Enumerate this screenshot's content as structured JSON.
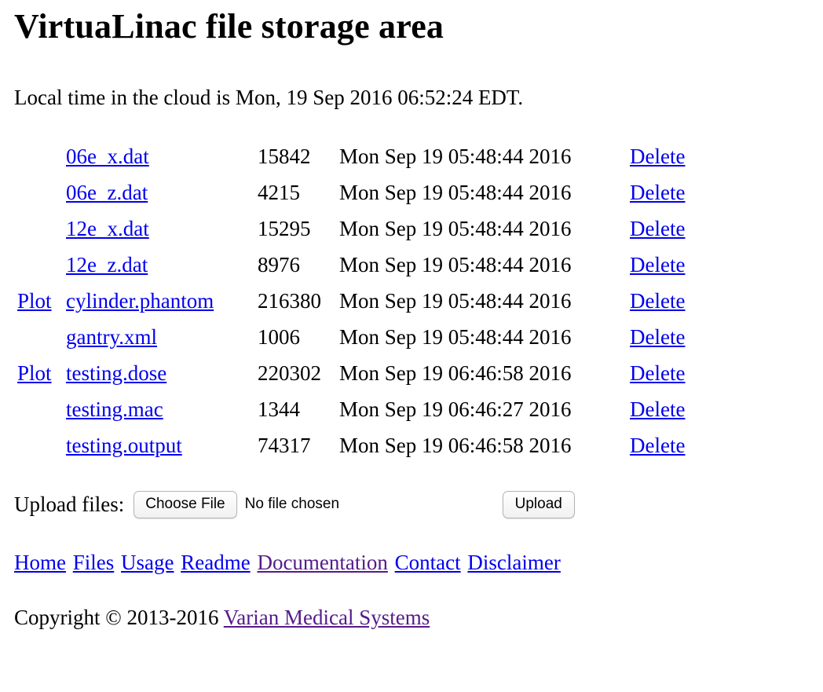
{
  "page": {
    "title": "VirtuaLinac file storage area",
    "local_time_text": "Local time in the cloud is Mon, 19 Sep 2016 06:52:24 EDT."
  },
  "files": [
    {
      "plot": "",
      "name": "06e_x.dat",
      "size": "15842",
      "date": "Mon Sep 19 05:48:44 2016",
      "delete": "Delete"
    },
    {
      "plot": "",
      "name": "06e_z.dat",
      "size": "4215",
      "date": "Mon Sep 19 05:48:44 2016",
      "delete": "Delete"
    },
    {
      "plot": "",
      "name": "12e_x.dat",
      "size": "15295",
      "date": "Mon Sep 19 05:48:44 2016",
      "delete": "Delete"
    },
    {
      "plot": "",
      "name": "12e_z.dat",
      "size": "8976",
      "date": "Mon Sep 19 05:48:44 2016",
      "delete": "Delete"
    },
    {
      "plot": "Plot",
      "name": "cylinder.phantom",
      "size": "216380",
      "date": "Mon Sep 19 05:48:44 2016",
      "delete": "Delete"
    },
    {
      "plot": "",
      "name": "gantry.xml",
      "size": "1006",
      "date": "Mon Sep 19 05:48:44 2016",
      "delete": "Delete"
    },
    {
      "plot": "Plot",
      "name": "testing.dose",
      "size": "220302",
      "date": "Mon Sep 19 06:46:58 2016",
      "delete": "Delete"
    },
    {
      "plot": "",
      "name": "testing.mac",
      "size": "1344",
      "date": "Mon Sep 19 06:46:27 2016",
      "delete": "Delete"
    },
    {
      "plot": "",
      "name": "testing.output",
      "size": "74317",
      "date": "Mon Sep 19 06:46:58 2016",
      "delete": "Delete"
    }
  ],
  "upload": {
    "label": "Upload files:",
    "choose_button": "Choose File",
    "status": "No file chosen",
    "upload_button": "Upload"
  },
  "nav": {
    "home": "Home",
    "files": "Files",
    "usage": "Usage",
    "readme": "Readme",
    "documentation": "Documentation",
    "contact": "Contact",
    "disclaimer": "Disclaimer"
  },
  "footer": {
    "copyright_text": "Copyright © 2013-2016",
    "company_link": "Varian Medical Systems"
  },
  "colors": {
    "link": "#0000ee",
    "visited_link": "#551a8b",
    "text": "#000000",
    "background": "#ffffff"
  }
}
